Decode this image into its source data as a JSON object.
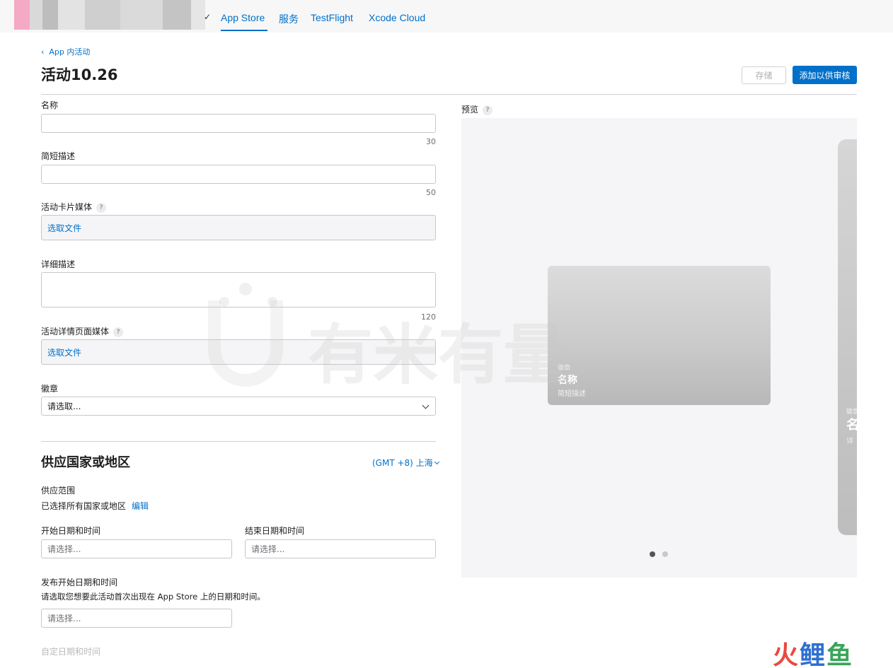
{
  "nav": {
    "tabs": [
      {
        "label": "App Store"
      },
      {
        "label": "服务"
      },
      {
        "label": "TestFlight"
      },
      {
        "label": "Xcode Cloud"
      }
    ]
  },
  "header": {
    "back_label": "App 内活动",
    "title": "活动10.26",
    "save_label": "存储",
    "submit_label": "添加以供审核"
  },
  "form": {
    "name": {
      "label": "名称",
      "value": "",
      "counter": "30"
    },
    "short_desc": {
      "label": "简短描述",
      "value": "",
      "counter": "50"
    },
    "card_media": {
      "label": "活动卡片媒体",
      "help": "?",
      "button": "选取文件"
    },
    "long_desc": {
      "label": "详细描述",
      "value": "",
      "counter": "120"
    },
    "detail_media": {
      "label": "活动详情页面媒体",
      "help": "?",
      "button": "选取文件"
    },
    "badge": {
      "label": "徽章",
      "selected": "请选取..."
    }
  },
  "availability": {
    "title": "供应国家或地区",
    "timezone": "(GMT +8) 上海",
    "scope_label": "供应范围",
    "scope_value": "已选择所有国家或地区",
    "edit_label": "编辑",
    "start_label": "开始日期和时间",
    "start_placeholder": "请选择...",
    "end_label": "结束日期和时间",
    "end_placeholder": "请选择...",
    "publish_label": "发布开始日期和时间",
    "publish_hint": "请选取您想要此活动首次出现在 App Store 上的日期和时间。",
    "publish_placeholder": "请选择...",
    "custom_label": "自定日期和时间"
  },
  "preview": {
    "label": "预览",
    "help": "?",
    "card": {
      "badge": "徽章",
      "name": "名称",
      "desc": "简短描述"
    },
    "detail": {
      "badge": "徽章",
      "name": "名",
      "desc": "详"
    },
    "pages": 2,
    "active_page": 1
  },
  "watermark": {
    "center_text": "有米有量",
    "brand": [
      "火",
      "鲤",
      "鱼"
    ]
  },
  "colors": {
    "accent": "#0070c9",
    "brand_red": "#e94a3f",
    "brand_blue": "#2f6fd1",
    "brand_green": "#3aa55a"
  }
}
